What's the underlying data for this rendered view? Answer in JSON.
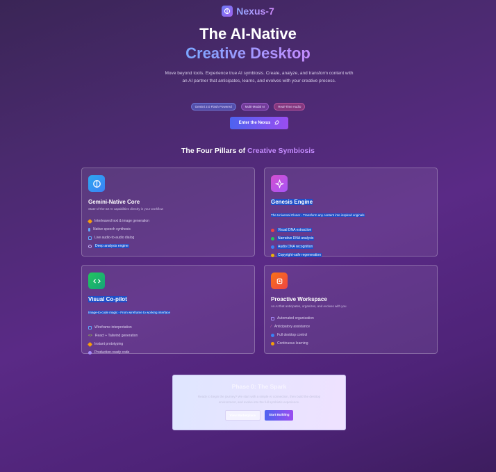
{
  "brand": {
    "name": "Nexus-7"
  },
  "hero": {
    "title_line1": "The AI-Native",
    "title_line2": "Creative Desktop",
    "subtitle": "Move beyond tools. Experience true AI symbiosis. Create, analyze, and transform content with an AI partner that anticipates, learns, and evolves with your creative process.",
    "badges": [
      "Gemini 2.0 Flash Powered",
      "Multi-Modal AI",
      "Real-Time Audio"
    ],
    "cta_label": "Enter the Nexus"
  },
  "pillars": {
    "title_prefix": "The Four Pillars of",
    "title_highlight": "Creative Symbiosis",
    "cards": [
      {
        "icon": "brain-icon",
        "title": "Gemini-Native Core",
        "subtitle": "State-of-the-art AI capabilities directly in your workflow",
        "features": [
          "Interleaved text & image generation",
          "Native speech synthesis",
          "Live audio-to-audio dialog",
          "Deep analysis engine"
        ]
      },
      {
        "icon": "sparkles-icon",
        "title": "Genesis Engine",
        "subtitle": "The Universal Cloner - Transform any content into inspired originals",
        "features": [
          "Visual DNA extraction",
          "Narrative DNA analysis",
          "Audio DNA recognition",
          "Copyright-safe regeneration"
        ]
      },
      {
        "icon": "code-icon",
        "title": "Visual Co-pilot",
        "subtitle": "Image-to-code magic - From wireframe to working interface",
        "features": [
          "Wireframe interpretation",
          "React + Tailwind generation",
          "Instant prototyping",
          "Production-ready code"
        ]
      },
      {
        "icon": "cpu-icon",
        "title": "Proactive Workspace",
        "subtitle": "An AI that anticipates, organizes, and evolves with you",
        "features": [
          "Automated organization",
          "Anticipatory assistance",
          "Full desktop control",
          "Continuous learning"
        ]
      }
    ]
  },
  "phase": {
    "title": "Phase 0: The Spark",
    "text": "Ready to begin the journey? We start with a simple AI connection, then build the desktop environment, and evolve into the full symbiotic experience.",
    "secondary_label": "View Marketplace",
    "primary_label": "Start Building"
  },
  "colors": {
    "accent_blue": "#4d63f0",
    "accent_purple": "#9a4df0",
    "selection": "#1f4fc8"
  }
}
